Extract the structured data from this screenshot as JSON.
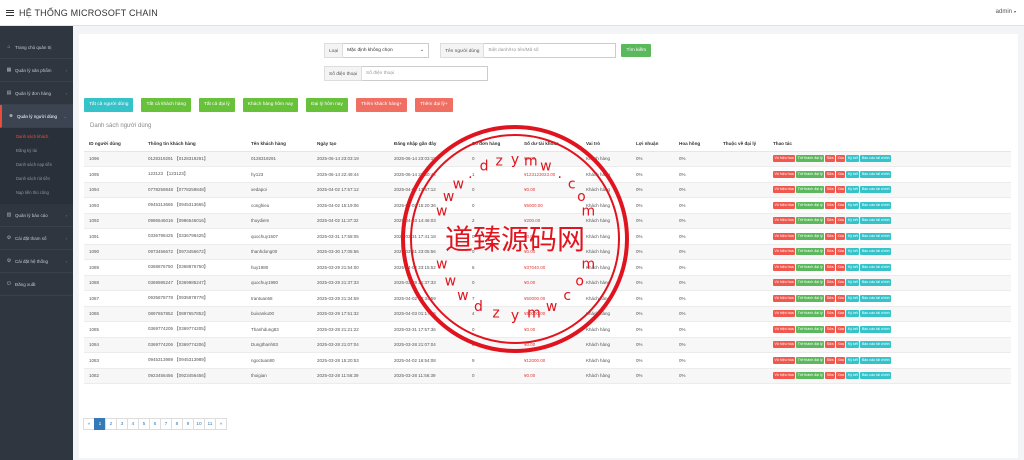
{
  "app": {
    "title": "HỆ THỐNG MICROSOFT CHAIN",
    "user_menu": "admin"
  },
  "sidebar": {
    "items": [
      {
        "label": "Trang chủ quản trị",
        "icon": "dashboard-icon"
      },
      {
        "label": "Quản lý sản phẩm",
        "icon": "products-icon"
      },
      {
        "label": "Quản lý đơn hàng",
        "icon": "orders-icon"
      },
      {
        "label": "Quản lý người dùng",
        "icon": "users-icon"
      },
      {
        "label": "Quản lý báo cáo",
        "icon": "report-icon"
      },
      {
        "label": "Cài đặt tham số",
        "icon": "settings-icon"
      },
      {
        "label": "Cài đặt hệ thống",
        "icon": "system-icon"
      },
      {
        "label": "Đăng xuất",
        "icon": "logout-icon"
      }
    ],
    "submenu": [
      "Danh sách khách",
      "Đăng ký tài",
      "Danh sách nạp tiền",
      "Danh sách rút tiền",
      "Nạp tiền thủ công"
    ]
  },
  "filters": {
    "type_label": "Loại",
    "type_value": "Mặc định không chọn",
    "username_label": "Tên người dùng",
    "username_placeholder": "Biệt danh/Họ tên/Mã số",
    "search_button": "Tìm kiếm",
    "phone_label": "Số điện thoại",
    "phone_placeholder": "Số điện thoại"
  },
  "actions": [
    "Tất cả người dùng",
    "Tất cả khách hàng",
    "Tất cả đại lý",
    "Khách hàng hôm nay",
    "Đại lý hôm nay",
    "Thêm khách hàng+",
    "Thêm đại lý+"
  ],
  "table": {
    "title": "Danh sách người dùng",
    "headers": [
      "ID người dùng",
      "Thông tin khách hàng",
      "Tên khách hàng",
      "Ngày tạo",
      "Đăng nhập gần đây",
      "Số đơn hàng",
      "Số dư tài khoản",
      "Vai trò",
      "Lợi nhuận",
      "Hoa hồng",
      "Thuộc về đại lý",
      "Thao tác"
    ],
    "row_buttons": [
      "Vô hiệu hóa",
      "Trở thành đại lý",
      "Sửa",
      "Xóa",
      "Ký kết",
      "Báo cáo tài chính"
    ],
    "rows": [
      [
        "1096",
        "0128319291 【0128319291】",
        "0128319291",
        "2025-06-14 23:03:19",
        "2025-06-14 23:03:19",
        "0",
        "¥0.00",
        "Khách hàng",
        "0%",
        "0%",
        ""
      ],
      [
        "1095",
        "123123 【123123】",
        "hy123",
        "2025-06-14 22:49:44",
        "2025-06-14 22:50:44",
        "1",
        "¥123123023.00",
        "Khách hàng",
        "0%",
        "0%",
        ""
      ],
      [
        "1094",
        "0778259848 【0778259848】",
        "xedapoi",
        "2025-04-02 17:57:12",
        "2025-04-02 17:57:12",
        "0",
        "¥0.00",
        "Khách hàng",
        "0%",
        "0%",
        ""
      ],
      [
        "1093",
        "0945313665 【0945313665】",
        "conghieu",
        "2025-04-02 15:19:06",
        "2025-04-02 15:20:36",
        "0",
        "¥5000.00",
        "Khách hàng",
        "0%",
        "0%",
        ""
      ],
      [
        "1092",
        "0986546016 【0986546016】",
        "thuydiem",
        "2025-04-02 11:37:32",
        "2025-04-03 14:46:03",
        "2",
        "¥200.00",
        "Khách hàng",
        "0%",
        "0%",
        ""
      ],
      [
        "1091",
        "0336798425 【0336798425】",
        "quochuy1507",
        "2025-03-31 17:58:05",
        "2025-03-31 17:41:18",
        "0",
        "¥0.00",
        "Khách hàng",
        "0%",
        "0%",
        ""
      ],
      [
        "1090",
        "0973456672 【0973456672】",
        "thanhdong00",
        "2025-03-30 17:05:56",
        "2025-03-31 23:05:56",
        "0",
        "¥0.00",
        "Khách hàng",
        "0%",
        "0%",
        ""
      ],
      [
        "1089",
        "0368876750 【0368876750】",
        "huy1980",
        "2025-03-29 21:54:00",
        "2025-04-02 23:15:52",
        "6",
        "¥37040.00",
        "Khách hàng",
        "0%",
        "0%",
        ""
      ],
      [
        "1088",
        "0369985247 【0369985247】",
        "quochuy1980",
        "2025-03-29 21:37:33",
        "2025-03-29 21:37:33",
        "0",
        "¥0.00",
        "Khách hàng",
        "0%",
        "0%",
        ""
      ],
      [
        "1087",
        "0935878778 【0935878778】",
        "trantuan68",
        "2025-03-29 21:34:59",
        "2025-04-02 23:34:59",
        "7",
        "¥50000.00",
        "Khách hàng",
        "0%",
        "0%",
        ""
      ],
      [
        "1086",
        "0897657852 【0897657852】",
        "buivanku00",
        "2025-03-29 17:51:32",
        "2025-04-03 01:17:46",
        "4",
        "¥50000.00",
        "Khách hàng",
        "0%",
        "0%",
        ""
      ],
      [
        "1085",
        "0369774205 【0369774205】",
        "Thanhdung83",
        "2025-03-28 21:21:22",
        "2025-03-31 17:57:36",
        "0",
        "¥0.00",
        "Khách hàng",
        "0%",
        "0%",
        ""
      ],
      [
        "1084",
        "0369774206 【0369774206】",
        "Dungthanh83",
        "2025-03-28 21:07:04",
        "2025-03-28 21:07:04",
        "0",
        "¥0.00",
        "Khách hàng",
        "0%",
        "0%",
        ""
      ],
      [
        "1083",
        "0945313989 【0945313989】",
        "ngoctuan80",
        "2025-03-28 15:20:53",
        "2025-04-02 16:54:08",
        "9",
        "¥12000.00",
        "Khách hàng",
        "0%",
        "0%",
        ""
      ],
      [
        "1082",
        "0923456456 【0923456456】",
        "thoigian",
        "2025-03-28 11:56:39",
        "2025-03-28 11:56:39",
        "0",
        "¥0.00",
        "Khách hàng",
        "0%",
        "0%",
        ""
      ]
    ]
  },
  "pagination": {
    "prev": "«",
    "pages": [
      "1",
      "2",
      "3",
      "4",
      "5",
      "6",
      "7",
      "8",
      "9",
      "10",
      "11"
    ],
    "next": "»",
    "current": "1"
  },
  "watermark": {
    "text": "道臻源码网",
    "url_letters": [
      "w",
      "w",
      "w",
      ".",
      "d",
      "z",
      "y",
      "m",
      "w",
      ".",
      "c",
      "o",
      "m"
    ],
    "url_letters_bottom": [
      "w",
      "w",
      "w",
      "d",
      "z",
      "y",
      "m",
      "w",
      "c",
      "o",
      "m"
    ],
    "color": "#e0141e"
  }
}
